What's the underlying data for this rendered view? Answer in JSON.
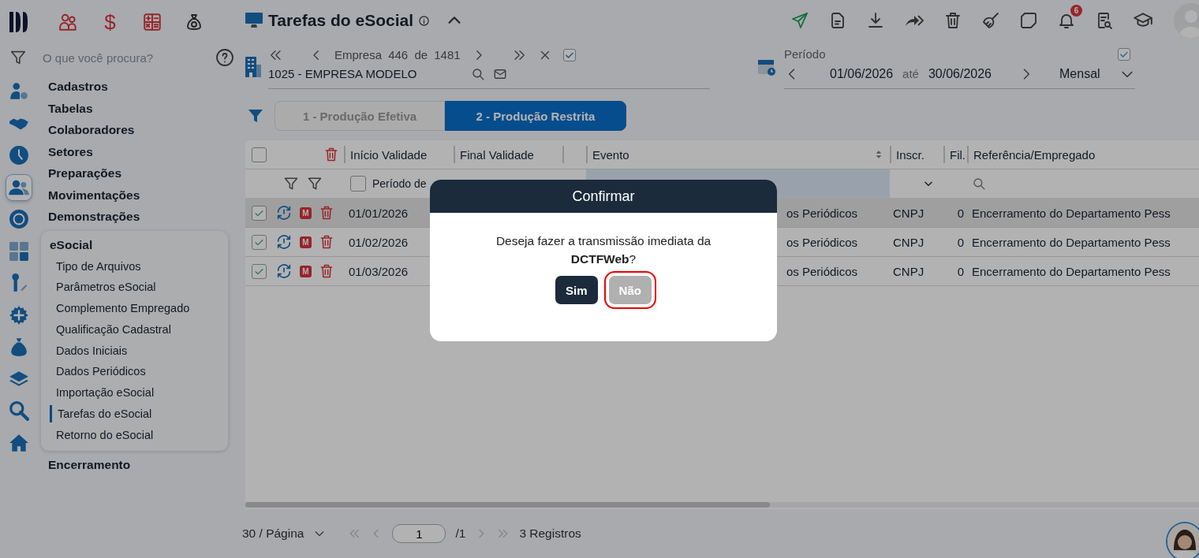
{
  "sidebar": {
    "shortcut_symbol": "$",
    "search": {
      "placeholder": "O que você procura?"
    },
    "rail": [
      {
        "kind": "user-gear",
        "selected": false
      },
      {
        "kind": "handshake",
        "selected": false
      },
      {
        "kind": "clock",
        "selected": false
      },
      {
        "kind": "people",
        "selected": true
      },
      {
        "kind": "coin",
        "selected": false
      },
      {
        "kind": "calculator",
        "selected": false
      },
      {
        "kind": "pen",
        "selected": false
      },
      {
        "kind": "gear",
        "selected": false
      },
      {
        "kind": "money-bag",
        "selected": false
      },
      {
        "kind": "layers",
        "selected": false
      },
      {
        "kind": "search",
        "selected": false
      },
      {
        "kind": "home",
        "selected": false
      }
    ],
    "menu": [
      {
        "label": "Cadastros",
        "expanded": false
      },
      {
        "label": "Tabelas",
        "expanded": false
      },
      {
        "label": "Colaboradores",
        "expanded": false
      },
      {
        "label": "Setores",
        "expanded": false
      },
      {
        "label": "Preparações",
        "expanded": false
      },
      {
        "label": "Movimentações",
        "expanded": false
      },
      {
        "label": "Demonstrações",
        "expanded": false
      },
      {
        "label": "eSocial",
        "expanded": true,
        "children": [
          {
            "label": "Tipo de Arquivos",
            "selected": false
          },
          {
            "label": "Parâmetros eSocial",
            "selected": false
          },
          {
            "label": "Complemento Empregado",
            "selected": false
          },
          {
            "label": "Qualificação Cadastral",
            "selected": false
          },
          {
            "label": "Dados Iniciais",
            "selected": false
          },
          {
            "label": "Dados Periódicos",
            "selected": false
          },
          {
            "label": "Importação eSocial",
            "selected": false
          },
          {
            "label": "Tarefas do eSocial",
            "selected": true
          },
          {
            "label": "Retorno do eSocial",
            "selected": false
          }
        ]
      },
      {
        "label": "Encerramento",
        "expanded": false
      }
    ]
  },
  "header": {
    "title": "Tarefas do eSocial",
    "notifications": "6"
  },
  "company": {
    "position": "Empresa 446 de 1481",
    "checked": true,
    "name": "1025 - EMPRESA MODELO"
  },
  "period": {
    "label": "Período",
    "checked": true,
    "from": "01/06/2026",
    "separator": "até",
    "to": "30/06/2026",
    "mode": "Mensal"
  },
  "tabs": [
    {
      "label": "1 - Produção Efetiva",
      "selected": false
    },
    {
      "label": "2 - Produção Restrita",
      "selected": true
    }
  ],
  "table": {
    "header_checked": false,
    "columns": [
      "Início Validade",
      "Final Validade",
      "Evento",
      "Inscr.",
      "Fil.",
      "Referência/Empregado"
    ],
    "filter": {
      "checked": false,
      "label": "Período de"
    },
    "rows": [
      {
        "selected": true,
        "checked": true,
        "badge": "M",
        "start": "01/01/2026",
        "event": "os Periódicos",
        "inscr": "CNPJ",
        "fil": "0",
        "reference": "Encerramento do Departamento Pess"
      },
      {
        "selected": false,
        "checked": true,
        "badge": "M",
        "start": "01/02/2026",
        "event": "os Periódicos",
        "inscr": "CNPJ",
        "fil": "0",
        "reference": "Encerramento do Departamento Pess"
      },
      {
        "selected": false,
        "checked": true,
        "badge": "M",
        "start": "01/03/2026",
        "event": "os Periódicos",
        "inscr": "CNPJ",
        "fil": "0",
        "reference": "Encerramento do Departamento Pess"
      }
    ]
  },
  "pagination": {
    "page_size": "30 / Página",
    "page": "1",
    "pages": "/1",
    "total": "3 Registros"
  },
  "dialog": {
    "title": "Confirmar",
    "message": "Deseja fazer a transmissão imediata da **DCTFWeb**?",
    "buttons": [
      {
        "label": "Sim",
        "kind": "primary",
        "focused": false
      },
      {
        "label": "Não",
        "kind": "secondary",
        "focused": true
      }
    ]
  }
}
